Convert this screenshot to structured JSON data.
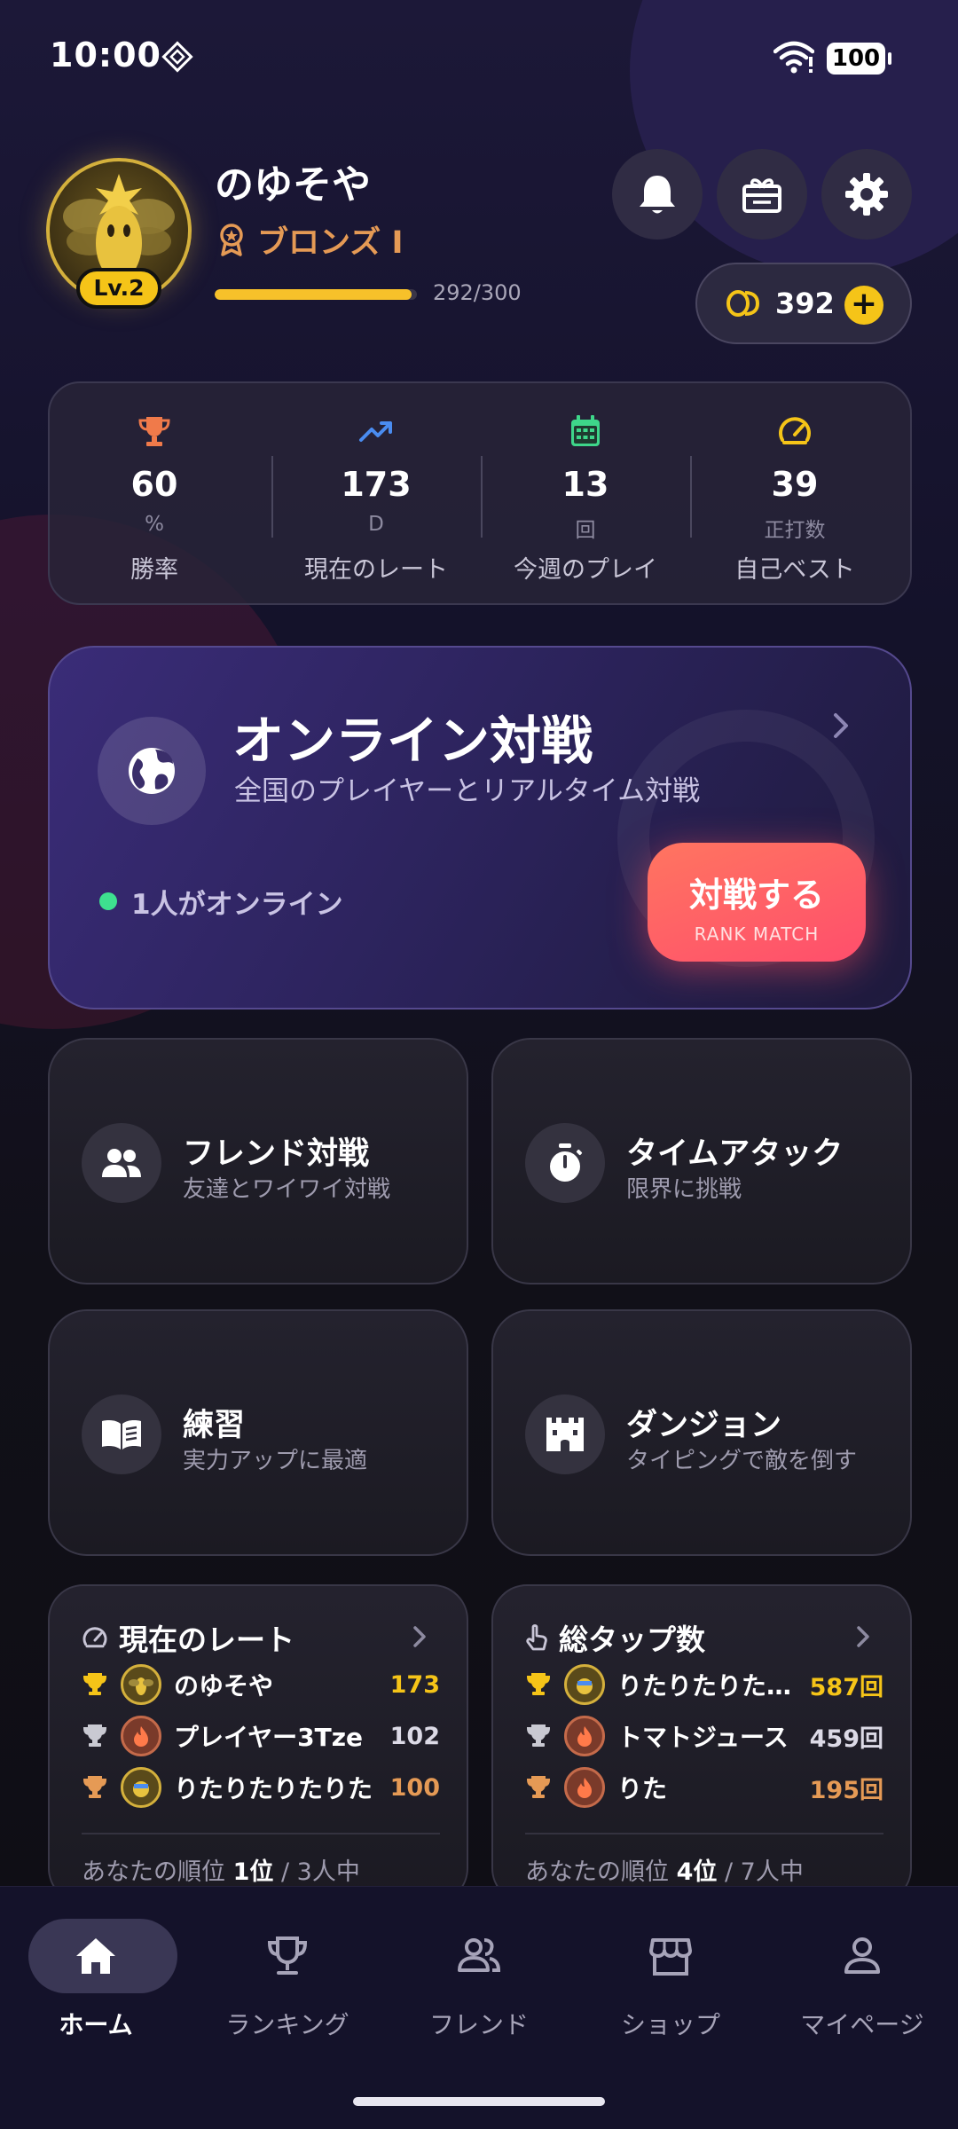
{
  "status_bar": {
    "time": "10:00",
    "battery": "100"
  },
  "profile": {
    "username": "のゆそや",
    "level": "Lv.2",
    "rank": "ブロンズ I",
    "xp_text": "292/300",
    "xp_progress": 0.973,
    "coins": "392"
  },
  "stats": [
    {
      "value": "60",
      "unit": "%",
      "label": "勝率",
      "icon": "trophy-icon",
      "color": "#f07a4a"
    },
    {
      "value": "173",
      "unit": "D",
      "label": "現在のレート",
      "icon": "trending-up-icon",
      "color": "#4a8cf0"
    },
    {
      "value": "13",
      "unit": "回",
      "label": "今週のプレイ",
      "icon": "calendar-icon",
      "color": "#3ed68a"
    },
    {
      "value": "39",
      "unit": "正打数",
      "label": "自己ベスト",
      "icon": "speedometer-icon",
      "color": "#f5c418"
    }
  ],
  "online": {
    "title": "オンライン対戦",
    "subtitle": "全国のプレイヤーとリアルタイム対戦",
    "online_count": "1人がオンライン",
    "button_label": "対戦する",
    "button_sub": "RANK MATCH"
  },
  "modes": [
    {
      "title": "フレンド対戦",
      "subtitle": "友達とワイワイ対戦",
      "icon": "people-icon"
    },
    {
      "title": "タイムアタック",
      "subtitle": "限界に挑戦",
      "icon": "stopwatch-icon"
    },
    {
      "title": "練習",
      "subtitle": "実力アップに最適",
      "icon": "book-icon"
    },
    {
      "title": "ダンジョン",
      "subtitle": "タイピングで敵を倒す",
      "icon": "castle-icon"
    }
  ],
  "rate_board": {
    "title": "現在のレート",
    "rows": [
      {
        "name": "のゆそや",
        "score": "173"
      },
      {
        "name": "プレイヤー3Tze",
        "score": "102"
      },
      {
        "name": "りたりたりたりた",
        "score": "100"
      }
    ],
    "footer_prefix": "あなたの順位 ",
    "footer_rank": "1位",
    "footer_suffix": " / 3人中"
  },
  "tap_board": {
    "title": "総タップ数",
    "rows": [
      {
        "name": "りたりたりたりた",
        "score": "587回"
      },
      {
        "name": "トマトジュース",
        "score": "459回"
      },
      {
        "name": "りた",
        "score": "195回"
      }
    ],
    "footer_prefix": "あなたの順位 ",
    "footer_rank": "4位",
    "footer_suffix": " / 7人中"
  },
  "nav": [
    {
      "label": "ホーム",
      "icon": "home-icon",
      "active": true
    },
    {
      "label": "ランキング",
      "icon": "trophy-icon",
      "active": false
    },
    {
      "label": "フレンド",
      "icon": "friends-icon",
      "active": false
    },
    {
      "label": "ショップ",
      "icon": "shop-icon",
      "active": false
    },
    {
      "label": "マイページ",
      "icon": "person-icon",
      "active": false
    }
  ],
  "colors": {
    "gold": "#f5c418",
    "bronze": "#e59a55",
    "silver": "#c9c9d2",
    "online_green": "#3ee08f",
    "battle_button": "#ff5e66"
  }
}
